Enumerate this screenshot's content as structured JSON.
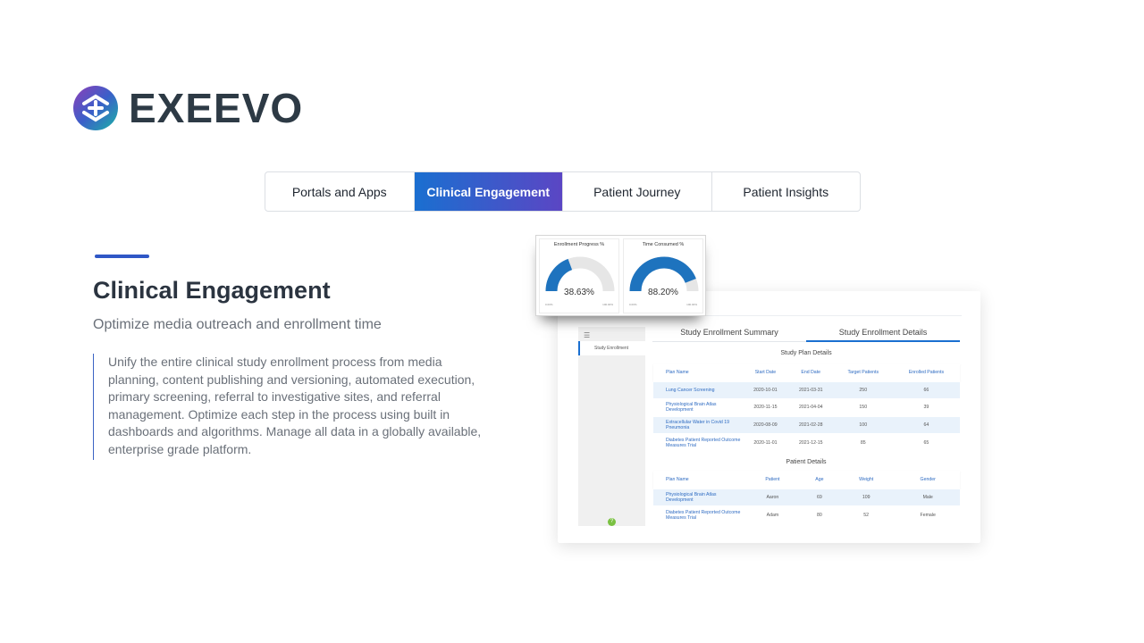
{
  "logo": {
    "text": "EXEEVO"
  },
  "tabs": [
    {
      "label": "Portals and Apps",
      "active": false
    },
    {
      "label": "Clinical Engagement",
      "active": true
    },
    {
      "label": "Patient Journey",
      "active": false
    },
    {
      "label": "Patient Insights",
      "active": false
    }
  ],
  "content": {
    "heading": "Clinical Engagement",
    "subheading": "Optimize media outreach and enrollment time",
    "description": "Unify the entire clinical study enrollment process from media planning, content publishing and versioning, automated execution, primary screening, referral to investigative sites, and referral management. Optimize each step in the process using built in dashboards and algorithms. Manage all data in a globally available, enterprise grade platform."
  },
  "gauges": [
    {
      "title": "Enrollment Progress %",
      "value_label": "38.63%",
      "value": 38.63,
      "min_label": "0.00%",
      "max_label": "100.00%"
    },
    {
      "title": "Time Consumed %",
      "value_label": "88.20%",
      "value": 88.2,
      "min_label": "0.00%",
      "max_label": "100.00%"
    }
  ],
  "dashboard": {
    "sidebar": {
      "item": "Study Enrollment"
    },
    "tabs": [
      {
        "label": "Study Enrollment Summary",
        "active": false
      },
      {
        "label": "Study Enrollment Details",
        "active": true
      }
    ],
    "study_plan": {
      "title": "Study Plan Details",
      "columns": [
        "Plan Name",
        "Start Date",
        "End Date",
        "Target Patients",
        "Enrolled Patients"
      ],
      "rows": [
        [
          "Lung Cancer Screening",
          "2020-10-01",
          "2021-03-31",
          "250",
          "66"
        ],
        [
          "Physiological Brain Atlas Development",
          "2020-11-15",
          "2021-04-04",
          "150",
          "39"
        ],
        [
          "Extracellular Water in Covid 19 Pneumonia",
          "2020-08-09",
          "2021-02-28",
          "100",
          "64"
        ],
        [
          "Diabetes Patient Reported Outcome Measures Trial",
          "2020-11-01",
          "2021-12-15",
          "85",
          "65"
        ]
      ]
    },
    "patient_details": {
      "title": "Patient Details",
      "columns": [
        "Plan Name",
        "Patient",
        "Age",
        "Weight",
        "Gender"
      ],
      "rows": [
        [
          "Physiological Brain Atlas Development",
          "Aaron",
          "69",
          "109",
          "Male"
        ],
        [
          "Diabetes Patient Reported Outcome Measures Trial",
          "Adam",
          "80",
          "52",
          "Female"
        ]
      ]
    }
  },
  "colors": {
    "accent": "#1a6fd0",
    "accent_end": "#5b46c4",
    "gauge_fill": "#1e73be",
    "gauge_track": "#e6e6e6"
  }
}
